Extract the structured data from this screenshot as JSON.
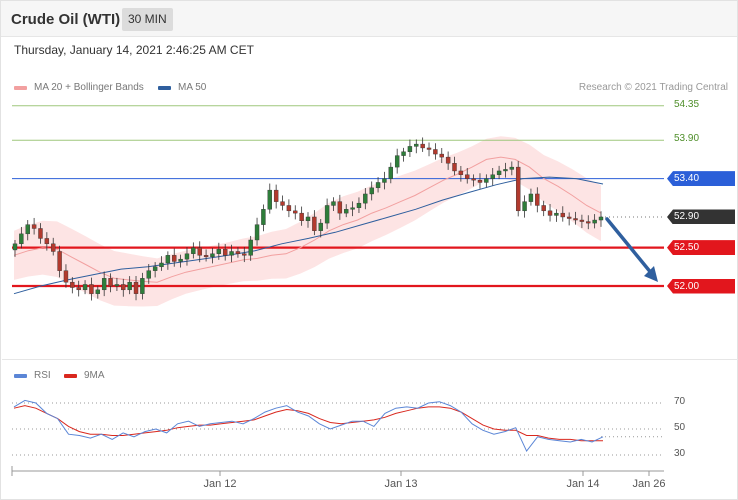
{
  "header": {
    "title": "Crude Oil (WTI)",
    "interval": "30 MIN"
  },
  "timestamp": "Thursday, January 14, 2021 2:46:25 AM CET",
  "copyright": "Research © 2021 Trading Central",
  "colors": {
    "bull": "#2e7d3a",
    "bear": "#b23a2e",
    "bollinger_fill": "#fde4e4",
    "ma20": "#f2a0a0",
    "ma50": "#2f5f9e",
    "support": "#e2161d",
    "resistance_blue": "#2b5fd8",
    "target_green": "#9fc77d",
    "rsi": "#5b86d6",
    "rsi_ma": "#d9281e",
    "arrow": "#2f5f9e"
  },
  "chart_data": [
    {
      "type": "candlestick",
      "title": "Crude Oil (WTI)",
      "timeframe": "30 MIN",
      "legend": [
        "MA 20 + Bollinger Bands",
        "MA 50"
      ],
      "legend_position": "top-left",
      "ylim": [
        51.71,
        54.5
      ],
      "x_ticks": [
        "Jan 12",
        "Jan 13",
        "Jan 14",
        "Jan 26"
      ],
      "levels": [
        {
          "label": "54.35",
          "value": 54.35,
          "kind": "target",
          "color": "#4f8f2a"
        },
        {
          "label": "53.90",
          "value": 53.9,
          "kind": "target",
          "color": "#4f8f2a"
        },
        {
          "label": "53.40",
          "value": 53.4,
          "kind": "resistance",
          "color": "#2b5fd8"
        },
        {
          "label": "52.90",
          "value": 52.9,
          "kind": "last",
          "color": "#333333"
        },
        {
          "label": "52.50",
          "value": 52.5,
          "kind": "support",
          "color": "#e2161d"
        },
        {
          "label": "52.00",
          "value": 52.0,
          "kind": "support",
          "color": "#e2161d"
        }
      ],
      "close": [
        52.55,
        52.68,
        52.8,
        52.75,
        52.62,
        52.55,
        52.45,
        52.2,
        52.05,
        51.98,
        51.95,
        52.02,
        51.9,
        51.95,
        52.1,
        52.0,
        52.02,
        51.95,
        52.05,
        51.9,
        52.1,
        52.2,
        52.25,
        52.3,
        52.4,
        52.32,
        52.35,
        52.42,
        52.5,
        52.4,
        52.38,
        52.42,
        52.48,
        52.4,
        52.45,
        52.42,
        52.4,
        52.6,
        52.8,
        53.0,
        53.25,
        53.1,
        53.05,
        52.98,
        52.95,
        52.85,
        52.9,
        52.72,
        52.82,
        53.05,
        53.1,
        52.95,
        53.0,
        53.02,
        53.08,
        53.2,
        53.28,
        53.35,
        53.4,
        53.55,
        53.7,
        53.75,
        53.82,
        53.85,
        53.8,
        53.78,
        53.72,
        53.68,
        53.6,
        53.5,
        53.45,
        53.4,
        53.38,
        53.35,
        53.4,
        53.45,
        53.5,
        53.52,
        53.55,
        52.98,
        53.1,
        53.2,
        53.05,
        52.98,
        52.92,
        52.95,
        52.9,
        52.88,
        52.86,
        52.84,
        52.82,
        52.86,
        52.9
      ],
      "ma20": [
        52.4,
        52.46,
        52.5,
        52.48,
        52.38,
        52.28,
        52.18,
        52.1,
        52.08,
        52.06,
        52.05,
        52.12,
        52.18,
        52.22,
        52.26,
        52.3,
        52.34,
        52.36,
        52.4,
        52.42,
        52.5,
        52.6,
        52.72,
        52.8,
        52.86,
        52.95,
        53.02,
        53.1,
        53.18,
        53.28,
        53.38,
        53.46,
        53.55,
        53.65,
        53.68,
        53.65,
        53.55,
        53.4,
        53.3,
        53.18,
        53.05,
        52.95
      ],
      "ma50": [
        51.9,
        52.0,
        52.08,
        52.15,
        52.22,
        52.25,
        52.3,
        52.35,
        52.4,
        52.46,
        52.55,
        52.62,
        52.7,
        52.8,
        52.9,
        53.0,
        53.12,
        53.22,
        53.32,
        53.4,
        53.42,
        53.4,
        53.33
      ],
      "annotation": "projected decline from 52.90 toward 52.00"
    },
    {
      "type": "line",
      "legend": [
        "RSI",
        "9MA"
      ],
      "ylim": [
        20,
        80
      ],
      "y_ticks": [
        70,
        50,
        30
      ],
      "series": [
        {
          "name": "RSI",
          "values": [
            67,
            72,
            70,
            62,
            58,
            46,
            45,
            43,
            46,
            42,
            47,
            44,
            48,
            50,
            47,
            54,
            56,
            52,
            54,
            55,
            56,
            54,
            58,
            63,
            66,
            68,
            63,
            60,
            54,
            50,
            53,
            56,
            56,
            52,
            62,
            66,
            67,
            66,
            70,
            71,
            68,
            63,
            54,
            49,
            46,
            48,
            51,
            33,
            44,
            42,
            41,
            40,
            42,
            40,
            44
          ]
        },
        {
          "name": "9MA",
          "values": [
            66,
            68,
            66,
            62,
            58,
            52,
            48,
            46,
            46,
            45,
            45,
            46,
            47,
            48,
            49,
            51,
            52,
            53,
            53,
            54,
            55,
            56,
            57,
            60,
            63,
            65,
            64,
            62,
            58,
            55,
            54,
            55,
            56,
            57,
            59,
            62,
            64,
            66,
            67,
            67,
            66,
            63,
            58,
            53,
            50,
            49,
            49,
            45,
            45,
            43,
            42,
            42,
            41,
            41,
            41
          ]
        }
      ]
    }
  ]
}
